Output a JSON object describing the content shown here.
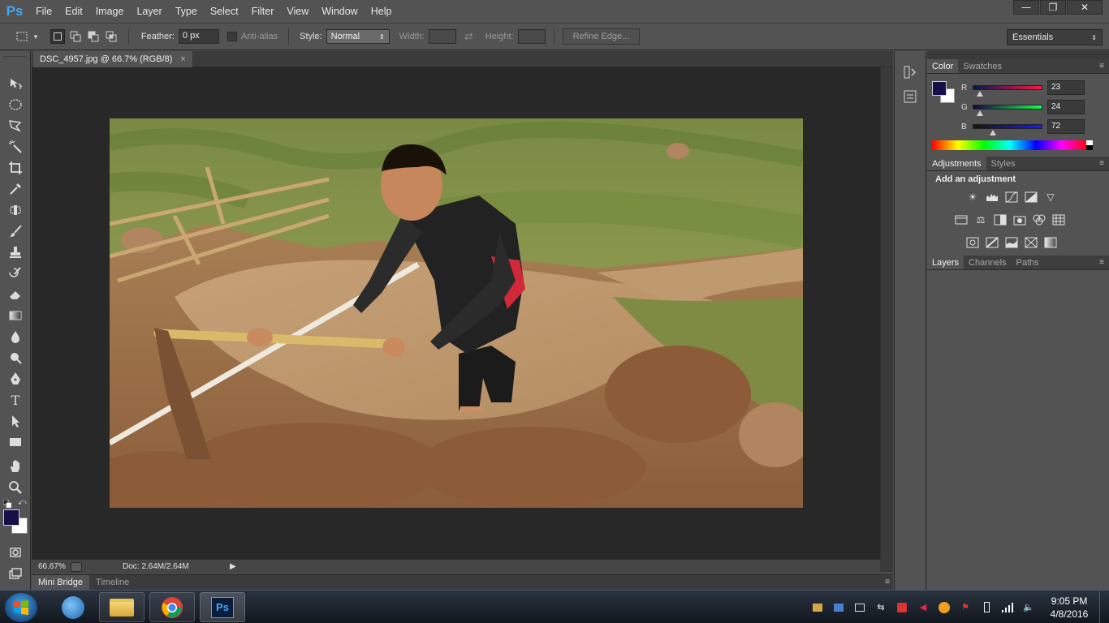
{
  "app": {
    "logo": "Ps"
  },
  "menu": [
    "File",
    "Edit",
    "Image",
    "Layer",
    "Type",
    "Select",
    "Filter",
    "View",
    "Window",
    "Help"
  ],
  "window_controls": {
    "minimize": "—",
    "restore": "❐",
    "close": "✕"
  },
  "options": {
    "feather_label": "Feather:",
    "feather_value": "0 px",
    "antialias_label": "Anti-alias",
    "style_label": "Style:",
    "style_value": "Normal",
    "width_label": "Width:",
    "height_label": "Height:",
    "refine_edge_label": "Refine Edge...",
    "workspace_value": "Essentials"
  },
  "document": {
    "tab_title": "DSC_4957.jpg @ 66.7% (RGB/8)",
    "close_glyph": "×"
  },
  "status": {
    "zoom": "66.67%",
    "doc_size": "Doc: 2.64M/2.64M",
    "arrow": "▶"
  },
  "bottom_tabs": [
    "Mini Bridge",
    "Timeline"
  ],
  "color_panel": {
    "tabs": [
      "Color",
      "Swatches"
    ],
    "foreground": "#170F48",
    "background": "#FFFFFF",
    "channels": [
      {
        "label": "R",
        "value": "23",
        "fraction": 0.09
      },
      {
        "label": "G",
        "value": "24",
        "fraction": 0.094
      },
      {
        "label": "B",
        "value": "72",
        "fraction": 0.282
      }
    ]
  },
  "adjustments_panel": {
    "tabs": [
      "Adjustments",
      "Styles"
    ],
    "heading": "Add an adjustment"
  },
  "layers_panel": {
    "tabs": [
      "Layers",
      "Channels",
      "Paths"
    ]
  },
  "taskbar": {
    "clock_time": "9:05 PM",
    "clock_date": "4/8/2016"
  }
}
